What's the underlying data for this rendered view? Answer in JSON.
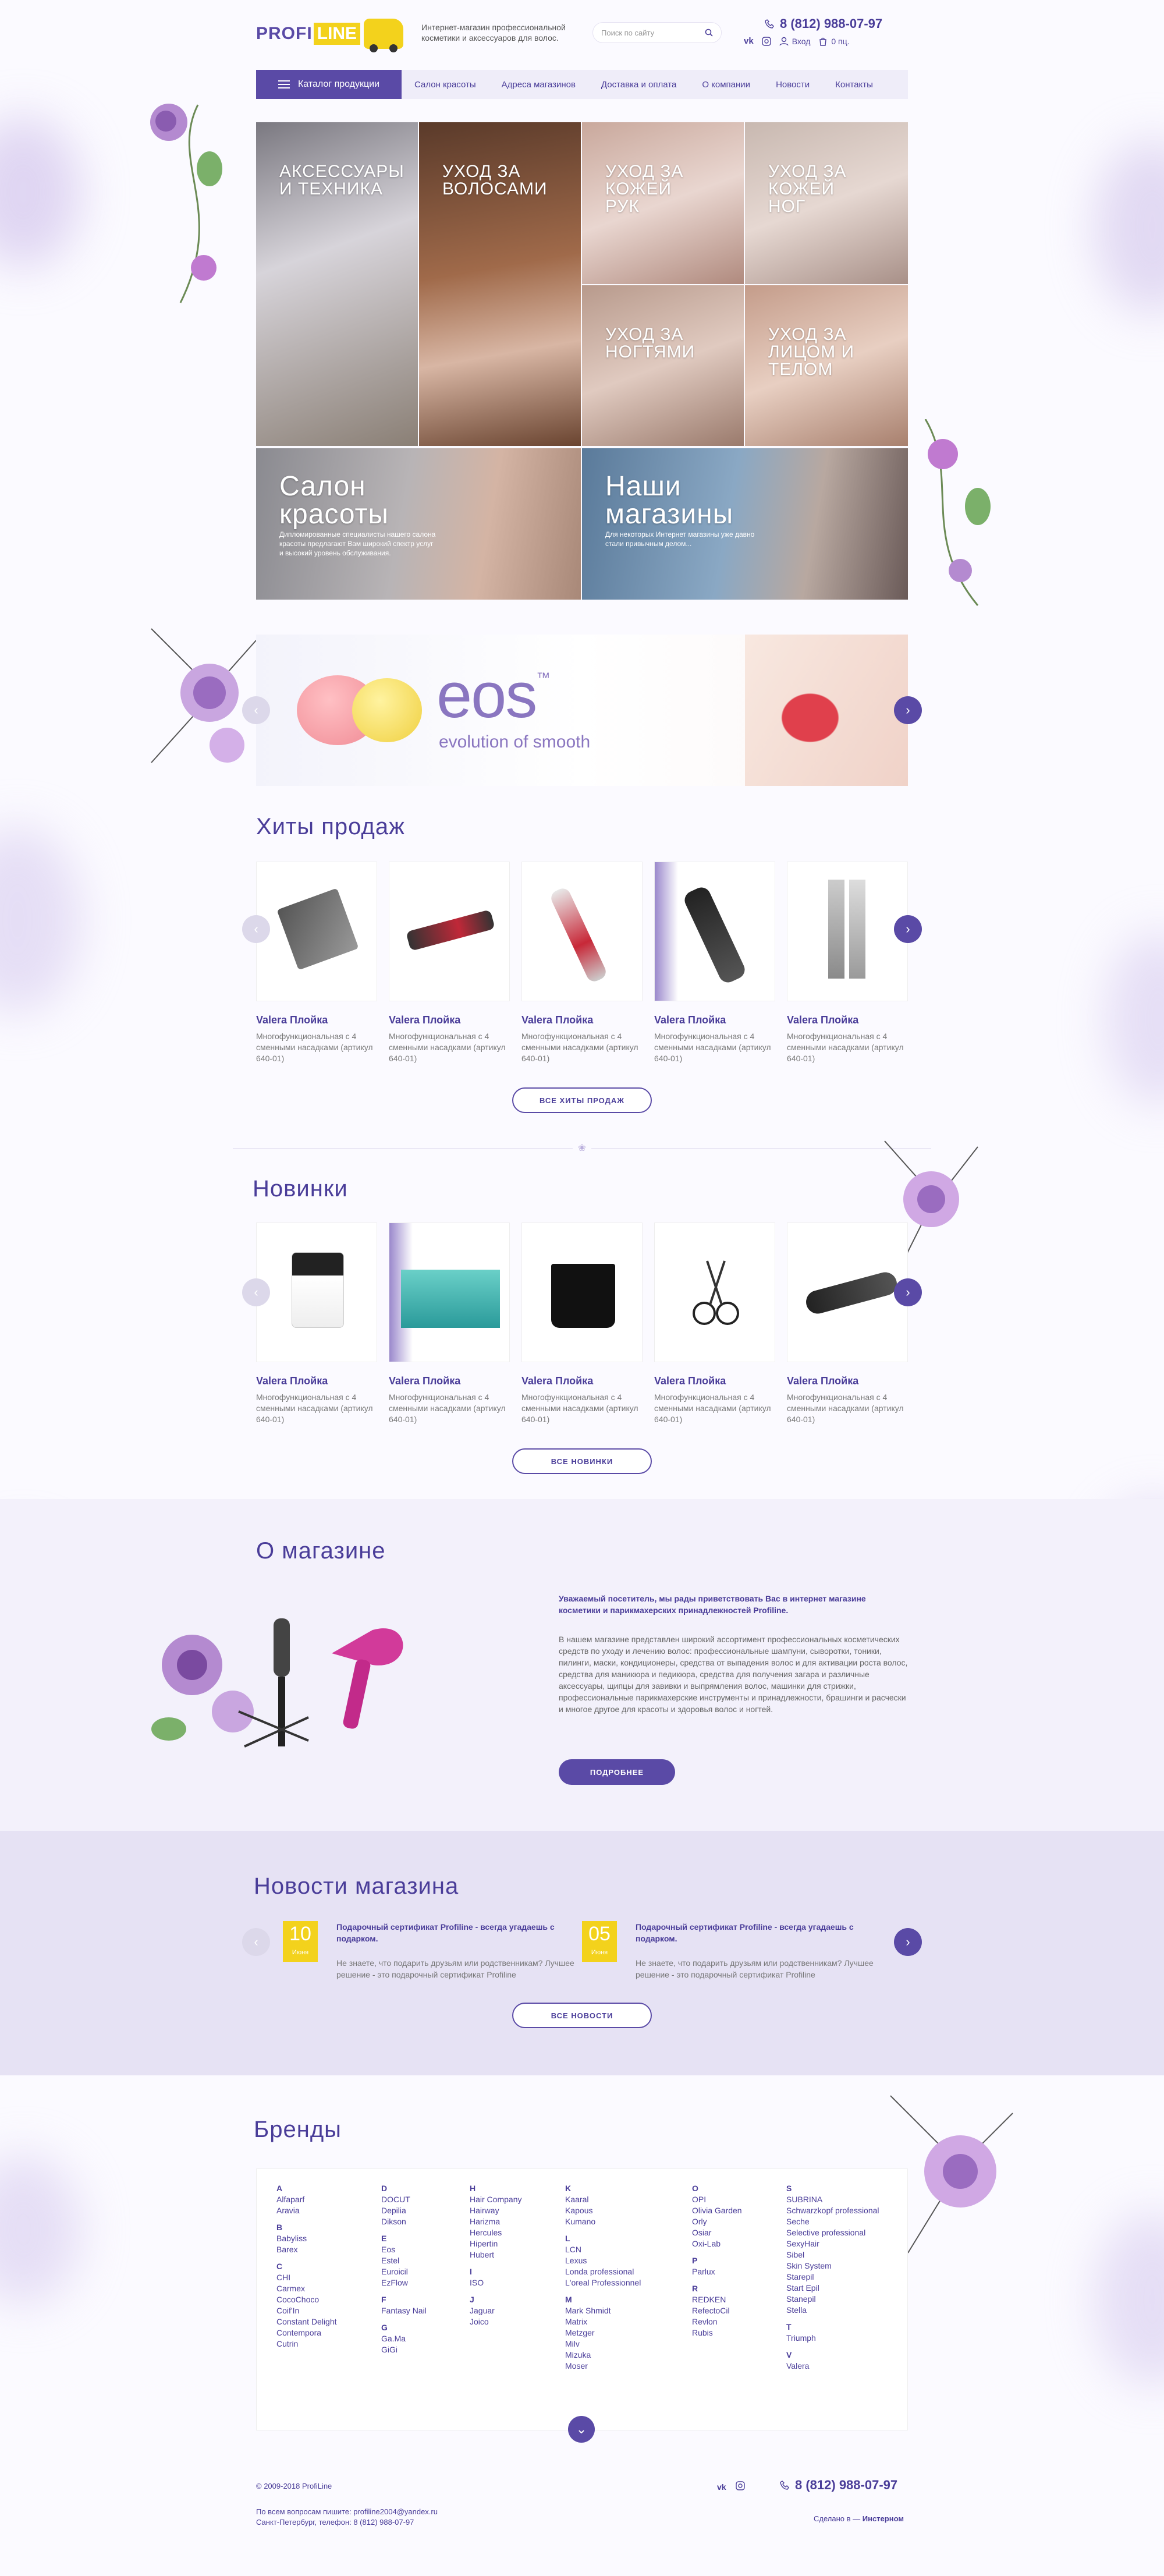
{
  "header": {
    "logo_part1": "PROFI",
    "logo_part2": "LINE",
    "tagline": "Интернет-магазин профессиональной косметики и аксессуаров для волос.",
    "search_placeholder": "Поиск по сайту",
    "phone": "8 (812) 988-07-97",
    "login": "Вход",
    "cart": "0 пц."
  },
  "nav": {
    "catalog": "Каталог продукции",
    "items": [
      "Салон красоты",
      "Адреса магазинов",
      "Доставка и оплата",
      "О компании",
      "Новости",
      "Контакты"
    ]
  },
  "tiles": [
    {
      "label": "Аксессуары и техника"
    },
    {
      "label": "Уход за волосами"
    },
    {
      "label": "Уход за кожей рук"
    },
    {
      "label": "Уход за кожей ног"
    },
    {
      "label": "Уход за ногтями"
    },
    {
      "label": "Уход за лицом и телом"
    },
    {
      "label": "Салон красоты",
      "desc": "Дипломированные специалисты нашего салона красоты предлагают Вам широкий спектр услуг и высокий уровень обслуживания."
    },
    {
      "label": "Наши магазины",
      "desc": "Для некоторых Интернет магазины уже давно стали привычным делом..."
    }
  ],
  "banner": {
    "brand": "eos",
    "tagline": "evolution of smooth",
    "tm": "™"
  },
  "hits": {
    "title": "Хиты продаж",
    "products": [
      {
        "name": "Valera Плойка",
        "desc": "Многофункциональная с 4 сменными насадками (артикул 640-01)"
      },
      {
        "name": "Valera Плойка",
        "desc": "Многофункциональная с 4 сменными насадками (артикул 640-01)"
      },
      {
        "name": "Valera Плойка",
        "desc": "Многофункциональная с 4 сменными насадками (артикул 640-01)"
      },
      {
        "name": "Valera Плойка",
        "desc": "Многофункциональная с 4 сменными насадками (артикул 640-01)"
      },
      {
        "name": "Valera Плойка",
        "desc": "Многофункциональная с 4 сменными насадками (артикул 640-01)"
      }
    ],
    "button": "ВСЕ ХИТЫ ПРОДАЖ"
  },
  "new": {
    "title": "Новинки",
    "products": [
      {
        "name": "Valera Плойка",
        "desc": "Многофункциональная с 4 сменными насадками (артикул 640-01)"
      },
      {
        "name": "Valera Плойка",
        "desc": "Многофункциональная с 4 сменными насадками (артикул 640-01)"
      },
      {
        "name": "Valera Плойка",
        "desc": "Многофункциональная с 4 сменными насадками (артикул 640-01)"
      },
      {
        "name": "Valera Плойка",
        "desc": "Многофункциональная с 4 сменными насадками (артикул 640-01)"
      },
      {
        "name": "Valera Плойка",
        "desc": "Многофункциональная с 4 сменными насадками (артикул 640-01)"
      }
    ],
    "button": "ВСЕ НОВИНКИ"
  },
  "about": {
    "title": "О магазине",
    "lead": "Уважаемый посетитель, мы рады приветствовать Вас в интернет магазине косметики и парикмахерских принадлежностей Profiline.",
    "text": "В нашем магазине представлен широкий ассортимент профессиональных косметических средств по уходу и лечению волос: профессиональные шампуни, сыворотки, тоники, пилинги, маски, кондиционеры, средства от выпадения волос и для активации роста волос, средства для маникюра и педикюра, средства для получения загара и различные аксессуары, щипцы для завивки и выпрямления волос, машинки для стрижки, профессиональные парикмахерские инструменты и принадлежности, брашинги и расчески и многое другое для красоты и здоровья волос и ногтей.",
    "button": "ПОДРОБНЕЕ"
  },
  "news": {
    "title": "Новости магазина",
    "items": [
      {
        "day": "10",
        "month": "Июня",
        "title": "Подарочный сертификат Profiline - всегда угадаешь с подарком.",
        "text": "Не знаете, что подарить друзьям или родственникам? Лучшее решение - это подарочный сертификат Profiline"
      },
      {
        "day": "05",
        "month": "Июня",
        "title": "Подарочный сертификат Profiline - всегда угадаешь с подарком.",
        "text": "Не знаете, что подарить друзьям или родственникам? Лучшее решение - это подарочный сертификат Profiline"
      }
    ],
    "button": "ВСЕ НОВОСТИ"
  },
  "brands": {
    "title": "Бренды",
    "columns": [
      [
        {
          "letter": "A",
          "names": [
            "Alfaparf",
            "Aravia"
          ]
        },
        {
          "letter": "B",
          "names": [
            "Babyliss",
            "Barex"
          ]
        },
        {
          "letter": "C",
          "names": [
            "CHI",
            "Carmex",
            "CocoChoco",
            "Coif'In",
            "Constant Delight",
            "Contempora",
            "Cutrin"
          ]
        }
      ],
      [
        {
          "letter": "D",
          "names": [
            "DOCUT",
            "Depilia",
            "Dikson"
          ]
        },
        {
          "letter": "E",
          "names": [
            "Eos",
            "Estel",
            "Euroicil",
            "EzFlow"
          ]
        },
        {
          "letter": "F",
          "names": [
            "Fantasy Nail"
          ]
        },
        {
          "letter": "G",
          "names": [
            "Ga.Ma",
            "GiGi"
          ]
        }
      ],
      [
        {
          "letter": "H",
          "names": [
            "Hair Company",
            "Hairway",
            "Harizma",
            "Hercules",
            "Hipertin",
            "Hubert"
          ]
        },
        {
          "letter": "I",
          "names": [
            "ISO"
          ]
        },
        {
          "letter": "J",
          "names": [
            "Jaguar",
            "Joico"
          ]
        }
      ],
      [
        {
          "letter": "K",
          "names": [
            "Kaaral",
            "Kapous",
            "Kumano"
          ]
        },
        {
          "letter": "L",
          "names": [
            "LCN",
            "Lexus",
            "Londa professional",
            "L'oreal Professionnel"
          ]
        },
        {
          "letter": "M",
          "names": [
            "Mark Shmidt",
            "Matrix",
            "Metzger",
            "Milv",
            "Mizuka",
            "Moser"
          ]
        }
      ],
      [
        {
          "letter": "O",
          "names": [
            "OPI",
            "Olivia Garden",
            "Orly",
            "Osiar",
            "Oxi-Lab"
          ]
        },
        {
          "letter": "P",
          "names": [
            "Parlux"
          ]
        },
        {
          "letter": "R",
          "names": [
            "REDKEN",
            "RefectoCil",
            "Revlon",
            "Rubis"
          ]
        }
      ],
      [
        {
          "letter": "S",
          "names": [
            "SUBRINA",
            "Schwarzkopf professional",
            "Seche",
            "Selective professional",
            "SexyHair",
            "Sibel",
            "Skin System",
            "Starepil",
            "Start Epil",
            "Stanepil",
            "Stella"
          ]
        },
        {
          "letter": "T",
          "names": [
            "Triumph"
          ]
        },
        {
          "letter": "V",
          "names": [
            "Valera"
          ]
        }
      ]
    ]
  },
  "footer": {
    "copyright": "© 2009-2018 ProfiLine",
    "email_line": "По всем вопросам пишите: profiline2004@yandex.ru",
    "address_line": "Санкт-Петербург, телефон: 8 (812) 988-07-97",
    "phone": "8 (812) 988-07-97",
    "made_prefix": "Сделано в — ",
    "made_by": "Инстерном"
  },
  "colors": {
    "accent": "#5a4aa6",
    "yellow": "#f3d21c",
    "lavender": "#efedf9"
  }
}
